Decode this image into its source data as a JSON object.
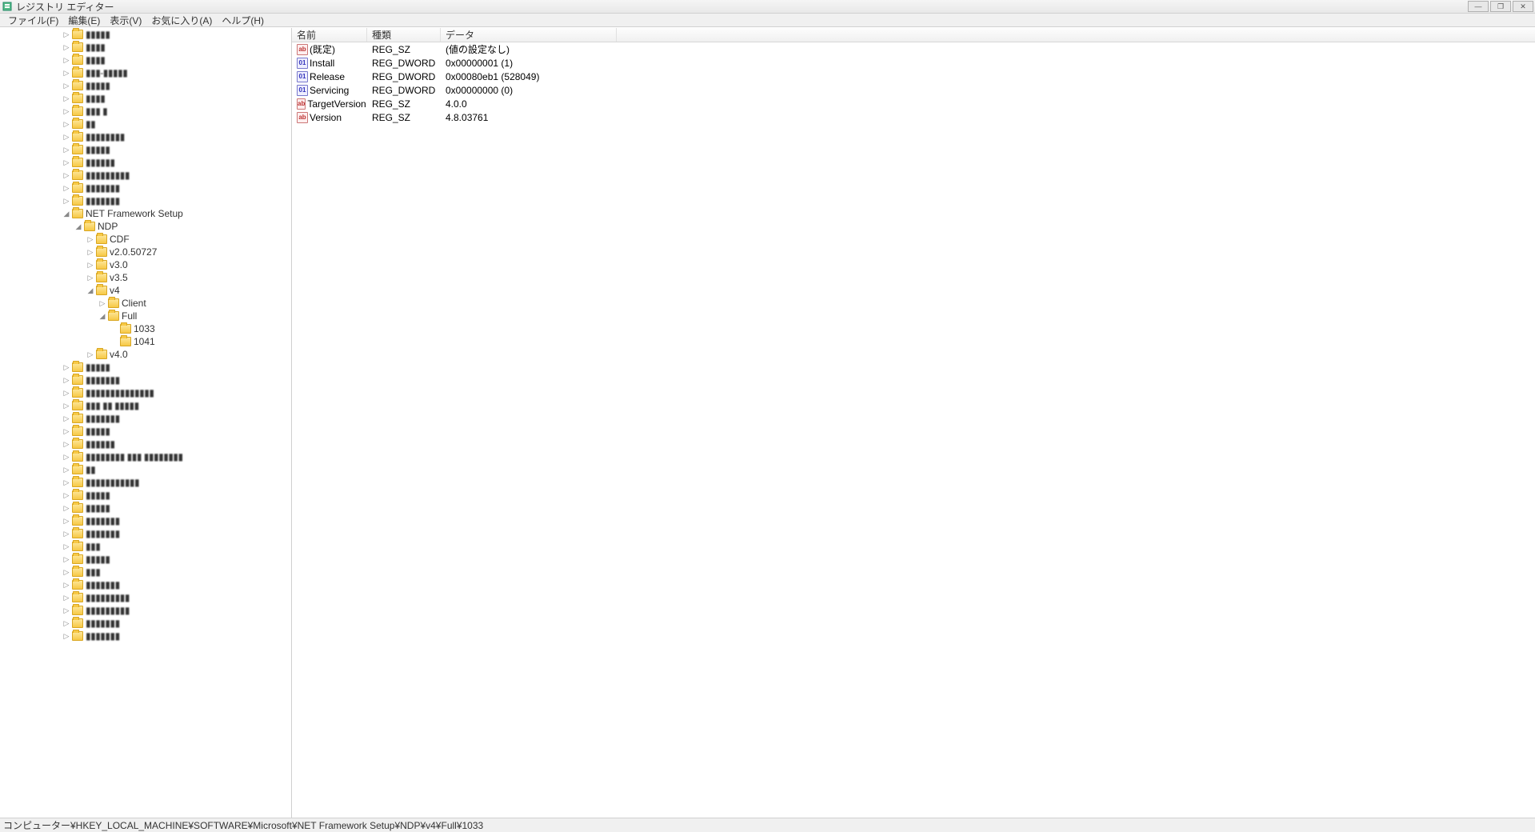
{
  "window": {
    "title": "レジストリ エディター"
  },
  "menu": {
    "file": "ファイル(F)",
    "edit": "編集(E)",
    "view": "表示(V)",
    "favorites": "お気に入り(A)",
    "help": "ヘルプ(H)"
  },
  "tree": {
    "blurred_top": [
      "▮▮▮▮▮",
      "▮▮▮▮",
      "▮▮▮▮",
      "▮▮▮-▮▮▮▮▮",
      "▮▮▮▮▮",
      "▮▮▮▮",
      "▮▮▮ ▮",
      "▮▮",
      "▮▮▮▮▮▮▮▮",
      "▮▮▮▮▮",
      "▮▮▮▮▮▮",
      "▮▮▮▮▮▮▮▮▮",
      "▮▮▮▮▮▮▮",
      "▮▮▮▮▮▮▮"
    ],
    "net_label": "NET Framework Setup",
    "ndp_label": "NDP",
    "ndp_children": [
      "CDF",
      "v2.0.50727",
      "v3.0",
      "v3.5"
    ],
    "v4_label": "v4",
    "v4_client": "Client",
    "v4_full": "Full",
    "full_children": [
      "1033",
      "1041"
    ],
    "v40_label": "v4.0",
    "blurred_bottom": [
      "▮▮▮▮▮",
      "▮▮▮▮▮▮▮",
      "▮▮▮▮▮▮▮▮▮▮▮▮▮▮",
      "▮▮▮ ▮▮ ▮▮▮▮▮",
      "▮▮▮▮▮▮▮",
      "▮▮▮▮▮",
      "▮▮▮▮▮▮",
      "▮▮▮▮▮▮▮▮ ▮▮▮ ▮▮▮▮▮▮▮▮",
      "▮▮",
      "▮▮▮▮▮▮▮▮▮▮▮",
      "▮▮▮▮▮",
      "▮▮▮▮▮",
      "▮▮▮▮▮▮▮",
      "▮▮▮▮▮▮▮",
      "▮▮▮",
      "▮▮▮▮▮",
      "▮▮▮",
      "▮▮▮▮▮▮▮",
      "▮▮▮▮▮▮▮▮▮",
      "▮▮▮▮▮▮▮▮▮",
      "▮▮▮▮▮▮▮",
      "▮▮▮▮▮▮▮"
    ]
  },
  "list": {
    "headers": {
      "name": "名前",
      "type": "種類",
      "data": "データ"
    },
    "rows": [
      {
        "icon": "sz",
        "name": "(既定)",
        "type": "REG_SZ",
        "data": "(値の設定なし)"
      },
      {
        "icon": "dw",
        "name": "Install",
        "type": "REG_DWORD",
        "data": "0x00000001 (1)"
      },
      {
        "icon": "dw",
        "name": "Release",
        "type": "REG_DWORD",
        "data": "0x00080eb1 (528049)"
      },
      {
        "icon": "dw",
        "name": "Servicing",
        "type": "REG_DWORD",
        "data": "0x00000000 (0)"
      },
      {
        "icon": "sz",
        "name": "TargetVersion",
        "type": "REG_SZ",
        "data": "4.0.0"
      },
      {
        "icon": "sz",
        "name": "Version",
        "type": "REG_SZ",
        "data": "4.8.03761"
      }
    ]
  },
  "statusbar": {
    "path": "コンピューター¥HKEY_LOCAL_MACHINE¥SOFTWARE¥Microsoft¥NET Framework Setup¥NDP¥v4¥Full¥1033"
  }
}
